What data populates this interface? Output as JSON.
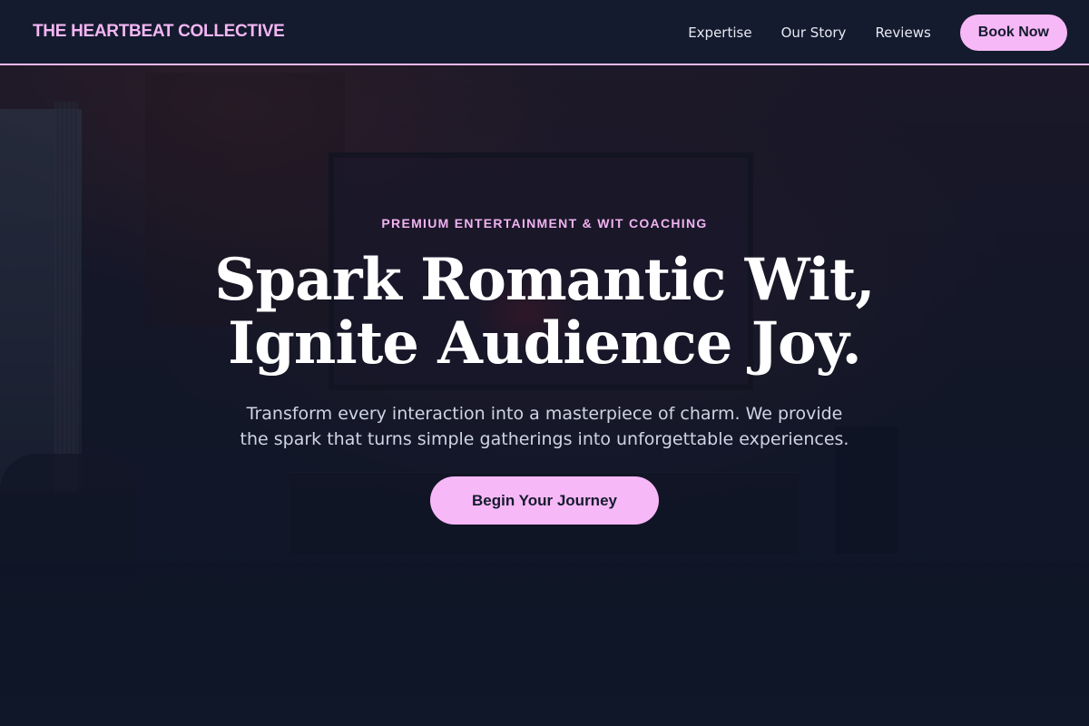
{
  "header": {
    "brand": "THE HEARTBEAT COLLECTIVE",
    "nav": [
      {
        "label": "Expertise"
      },
      {
        "label": "Our Story"
      },
      {
        "label": "Reviews"
      }
    ],
    "cta_label": "Book Now"
  },
  "hero": {
    "eyebrow": "PREMIUM ENTERTAINMENT & WIT COACHING",
    "headline_line1": "Spark Romantic Wit,",
    "headline_line2": "Ignite Audience Joy.",
    "subtext": "Transform every interaction into a masterpiece of charm. We provide the spark that turns simple gatherings into unforgettable experiences.",
    "cta_label": "Begin Your Journey"
  },
  "colors": {
    "accent": "#f7b8f7",
    "navbar_bg": "#141b2e",
    "page_bg": "#111a2c",
    "headline": "#ffffff",
    "body_text": "#cfd4e2"
  }
}
